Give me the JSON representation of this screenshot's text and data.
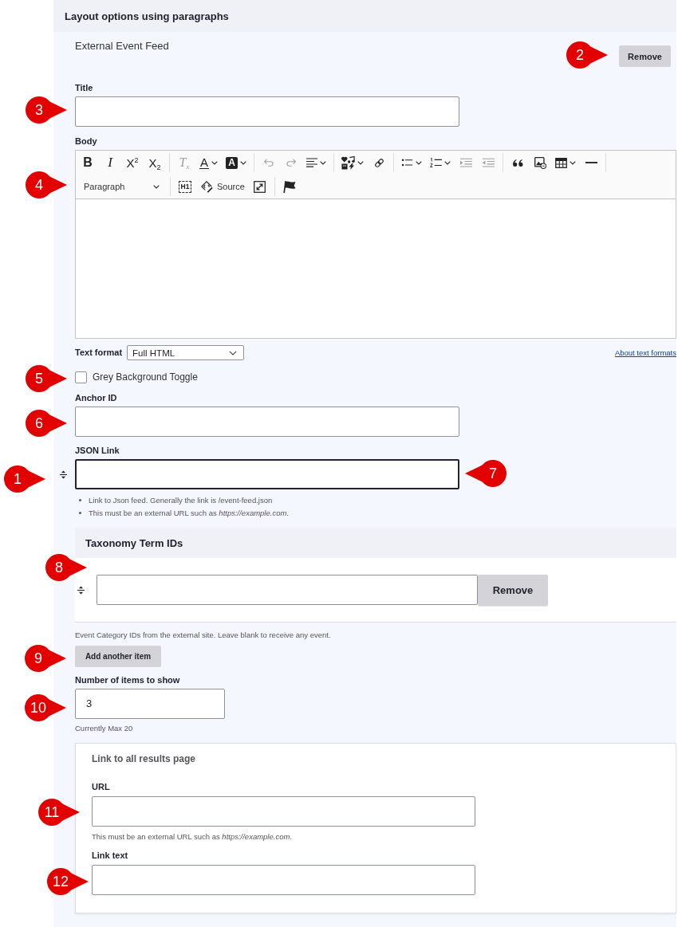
{
  "section": {
    "title": "Layout options using paragraphs"
  },
  "paragraph": {
    "type_label": "External Event Feed",
    "remove_button": "Remove"
  },
  "title_field": {
    "label": "Title"
  },
  "body": {
    "label": "Body",
    "toolbar": {
      "rows": [
        {
          "groups": [
            {
              "items": [
                {
                  "kind": "bold",
                  "text": "B",
                  "dropdown": false,
                  "disabled": false
                },
                {
                  "kind": "italic",
                  "text": "I",
                  "dropdown": false,
                  "disabled": false
                },
                {
                  "kind": "superscript",
                  "text": "X$^{2}$",
                  "dropdown": false,
                  "disabled": false
                },
                {
                  "kind": "subscript",
                  "text": "X$_{2}$",
                  "dropdown": false,
                  "disabled": false
                }
              ]
            },
            {
              "items": [
                {
                  "kind": "remove-format",
                  "text": "T$_{x}$",
                  "dropdown": false,
                  "disabled": true
                },
                {
                  "kind": "font-color",
                  "text": "A",
                  "dropdown": true,
                  "disabled": false
                },
                {
                  "kind": "background-color",
                  "text": "A",
                  "dropdown": true,
                  "disabled": false
                }
              ]
            },
            {
              "items": [
                {
                  "kind": "undo",
                  "dropdown": false,
                  "disabled": true
                },
                {
                  "kind": "redo",
                  "dropdown": false,
                  "disabled": true
                },
                {
                  "kind": "align",
                  "dropdown": true,
                  "disabled": false
                }
              ]
            },
            {
              "items": [
                {
                  "kind": "special-characters",
                  "dropdown": true,
                  "disabled": false
                },
                {
                  "kind": "link",
                  "dropdown": false,
                  "disabled": false
                }
              ]
            },
            {
              "items": [
                {
                  "kind": "bulleted-list",
                  "dropdown": true,
                  "disabled": false
                },
                {
                  "kind": "numbered-list",
                  "dropdown": true,
                  "disabled": false
                },
                {
                  "kind": "indent",
                  "dropdown": false,
                  "disabled": true
                },
                {
                  "kind": "outdent",
                  "dropdown": false,
                  "disabled": true
                }
              ]
            },
            {
              "items": [
                {
                  "kind": "block-quote",
                  "dropdown": false,
                  "disabled": false
                },
                {
                  "kind": "image",
                  "dropdown": false,
                  "disabled": false
                },
                {
                  "kind": "table",
                  "dropdown": true,
                  "disabled": false
                },
                {
                  "kind": "horizontal-line",
                  "dropdown": false,
                  "disabled": false
                }
              ]
            }
          ]
        },
        {
          "groups": [
            {
              "items": [
                {
                  "kind": "heading",
                  "text": "Paragraph",
                  "dropdown": true,
                  "disabled": false
                }
              ]
            },
            {
              "items": [
                {
                  "kind": "heading-id",
                  "text": "H1",
                  "dropdown": false,
                  "disabled": false
                },
                {
                  "kind": "source",
                  "text": "Source",
                  "dropdown": false,
                  "disabled": false
                },
                {
                  "kind": "maximize",
                  "dropdown": false,
                  "disabled": false
                }
              ]
            },
            {
              "items": [
                {
                  "kind": "flag",
                  "dropdown": false,
                  "disabled": false
                }
              ]
            }
          ]
        }
      ]
    },
    "text_format": {
      "label": "Text format",
      "value": "Full HTML",
      "help_link": "About text formats"
    }
  },
  "grey_background": {
    "label": "Grey Background Toggle",
    "checked": false
  },
  "anchor_id": {
    "label": "Anchor ID"
  },
  "json_link": {
    "label": "JSON Link",
    "focused": true,
    "help": [
      "Link to Json feed. Generally the link is /event-feed.json",
      "This must be an external URL such as *https://example.com*."
    ]
  },
  "taxonomy": {
    "title": "Taxonomy Term IDs",
    "rows": [
      {
        "remove_button": "Remove"
      }
    ],
    "description": "Event Category IDs from the external site. Leave blank to receive any event.",
    "add_button": "Add another item"
  },
  "items_to_show": {
    "label": "Number of items to show",
    "value": "3",
    "description": "Currently Max 20"
  },
  "results_link": {
    "legend": "Link to all results page",
    "url": {
      "label": "URL",
      "description": "This must be an external URL such as *https://example.com*."
    },
    "link_text": {
      "label": "Link text"
    }
  },
  "callouts": [
    {
      "number": "1",
      "kind": "right"
    },
    {
      "number": "2",
      "kind": "right"
    },
    {
      "number": "3",
      "kind": "right"
    },
    {
      "number": "4",
      "kind": "right"
    },
    {
      "number": "5",
      "kind": "right"
    },
    {
      "number": "6",
      "kind": "right"
    },
    {
      "number": "7",
      "kind": "left"
    },
    {
      "number": "8",
      "kind": "right"
    },
    {
      "number": "9",
      "kind": "right"
    },
    {
      "number": "10",
      "kind": "right"
    },
    {
      "number": "11",
      "kind": "right"
    },
    {
      "number": "12",
      "kind": "right"
    }
  ]
}
